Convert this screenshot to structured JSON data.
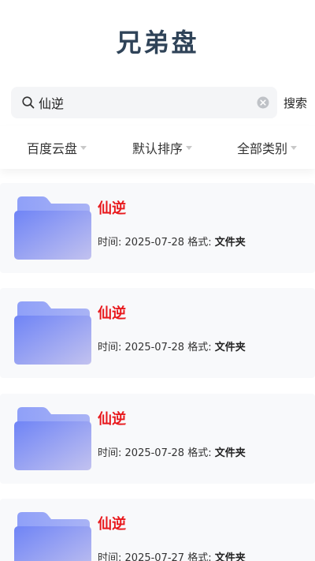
{
  "app": {
    "title": "兄弟盘"
  },
  "search": {
    "query": "仙逆",
    "button_label": "搜索"
  },
  "filters": [
    {
      "label": "百度云盘"
    },
    {
      "label": "默认排序"
    },
    {
      "label": "全部类别"
    }
  ],
  "results": [
    {
      "title": "仙逆",
      "time_label": "时间:",
      "time": "2025-07-28",
      "format_label": "格式:",
      "format": "文件夹"
    },
    {
      "title": "仙逆",
      "time_label": "时间:",
      "time": "2025-07-28",
      "format_label": "格式:",
      "format": "文件夹"
    },
    {
      "title": "仙逆",
      "time_label": "时间:",
      "time": "2025-07-28",
      "format_label": "格式:",
      "format": "文件夹"
    },
    {
      "title": "仙逆",
      "time_label": "时间:",
      "time": "2025-07-27",
      "format_label": "格式:",
      "format": "文件夹"
    }
  ],
  "colors": {
    "title": "#2f4358",
    "accent_red": "#e8191d",
    "folder_blue": "#7b8ff7"
  },
  "icons": {
    "search": "search-icon",
    "clear": "clear-icon",
    "folder": "folder-icon",
    "dropdown": "chevron-down-icon"
  }
}
